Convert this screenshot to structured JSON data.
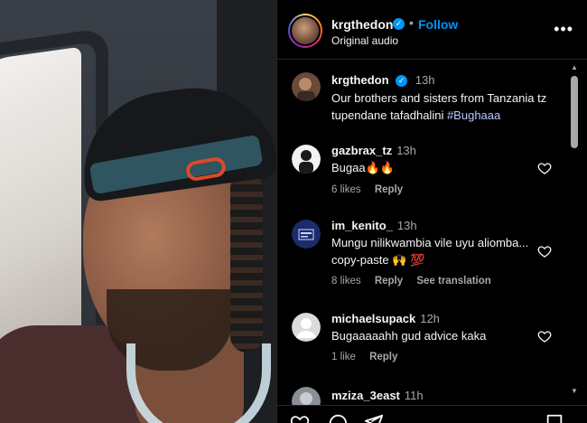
{
  "header": {
    "username": "krgthedon",
    "verified_icon": "verified-badge-icon",
    "separator": "•",
    "follow_label": "Follow",
    "audio": "Original audio"
  },
  "caption": {
    "username": "krgthedon",
    "time": "13h",
    "text_main": "Our brothers and sisters from Tanzania tz tupendane tafadhalini ",
    "hashtag": "#Bughaaa"
  },
  "comments": [
    {
      "username": "gazbrax_tz",
      "time": "13h",
      "text": "Bugaa🔥🔥",
      "likes": "6 likes",
      "reply": "Reply",
      "extra": ""
    },
    {
      "username": "im_kenito_",
      "time": "13h",
      "text": "Mungu nilikwambia vile uyu aliomba... copy-paste 🙌 💯",
      "likes": "8 likes",
      "reply": "Reply",
      "extra": "See translation"
    },
    {
      "username": "michaelsupack",
      "time": "12h",
      "text": "Bugaaaaahh gud advice kaka",
      "likes": "1 like",
      "reply": "Reply",
      "extra": ""
    },
    {
      "username": "mziza_3east",
      "time": "11h",
      "text": "",
      "likes": "",
      "reply": "",
      "extra": ""
    }
  ],
  "colors": {
    "accent": "#0095f6",
    "background": "#000000",
    "muted": "#a8a8a8"
  },
  "icons": [
    "more-options-icon",
    "heart-icon",
    "comment-icon",
    "share-icon",
    "bookmark-icon"
  ]
}
